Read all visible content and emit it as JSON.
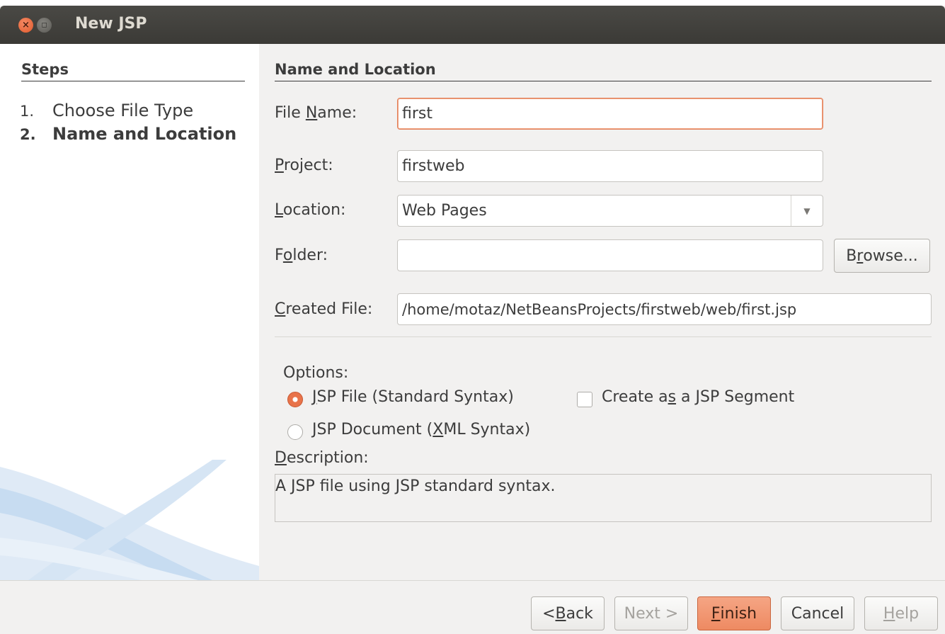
{
  "window": {
    "title": "New JSP",
    "close_glyph": "×",
    "max_glyph": "◻"
  },
  "steps": {
    "title": "Steps",
    "items": [
      {
        "num": "1.",
        "label": "Choose File Type"
      },
      {
        "num": "2.",
        "label": "Name and Location"
      }
    ]
  },
  "panel": {
    "title": "Name and Location",
    "file_name": {
      "label_pre": "File ",
      "label_u": "N",
      "label_post": "ame:",
      "value": "first"
    },
    "project": {
      "label_pre": "",
      "label_u": "P",
      "label_post": "roject:",
      "value": "firstweb"
    },
    "location": {
      "label_pre": "",
      "label_u": "L",
      "label_post": "ocation:",
      "value": "Web Pages",
      "arrow": "▼"
    },
    "folder": {
      "label_pre": "F",
      "label_u": "o",
      "label_post": "lder:",
      "value": ""
    },
    "browse": {
      "pre": "B",
      "u": "r",
      "post": "owse..."
    },
    "created_file": {
      "label_pre": "",
      "label_u": "C",
      "label_post": "reated File:",
      "value": "/home/motaz/NetBeansProjects/firstweb/web/first.jsp"
    },
    "options_label": "Options:",
    "opt_jsp": {
      "pre": "",
      "u": "J",
      "post": "SP File (Standard Syntax)",
      "checked": true
    },
    "opt_doc": {
      "pre": "JSP Document (",
      "u": "X",
      "post": "ML Syntax)",
      "checked": false
    },
    "opt_segment": {
      "pre": "Create a",
      "u": "s",
      "post": " a JSP Segment",
      "checked": false
    },
    "description_label": {
      "pre": "",
      "u": "D",
      "post": "escription:"
    },
    "description": "A JSP file using JSP standard syntax."
  },
  "buttons": {
    "back": {
      "pre": "< ",
      "u": "B",
      "post": "ack"
    },
    "next": "Next >",
    "finish": {
      "pre": "",
      "u": "F",
      "post": "inish"
    },
    "cancel": "Cancel",
    "help": {
      "pre": "",
      "u": "H",
      "post": "elp"
    }
  },
  "colors": {
    "accent": "#e8734a",
    "titlebar": "#3b3a36",
    "window_bg": "#f2f1f0"
  }
}
